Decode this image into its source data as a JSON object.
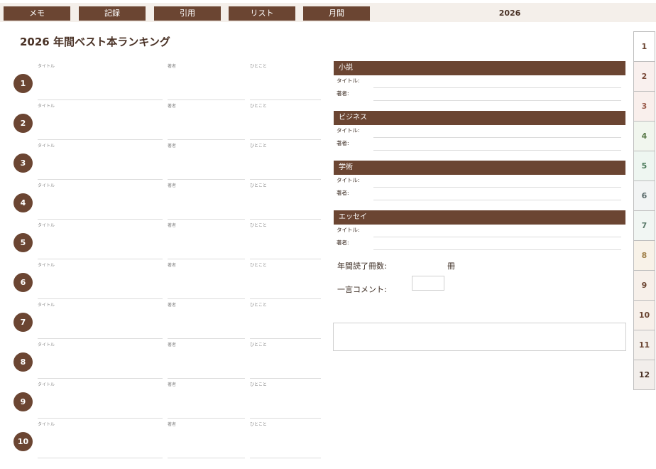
{
  "nav": {
    "tabs": [
      "メモ",
      "記録",
      "引用",
      "リスト",
      "月間"
    ],
    "year": "2026"
  },
  "page_title": "2026 年間ベスト本ランキング",
  "ranking": {
    "col_labels": {
      "title": "タイトル",
      "author": "著者",
      "note": "ひとこと"
    },
    "ranks": [
      "1",
      "2",
      "3",
      "4",
      "5",
      "6",
      "7",
      "8",
      "9",
      "10"
    ]
  },
  "categories": [
    {
      "name": "小説",
      "title_label": "タイトル:",
      "author_label": "著者:"
    },
    {
      "name": "ビジネス",
      "title_label": "タイトル:",
      "author_label": "著者:"
    },
    {
      "name": "学術",
      "title_label": "タイトル:",
      "author_label": "著者:"
    },
    {
      "name": "エッセイ",
      "title_label": "タイトル:",
      "author_label": "著者:"
    }
  ],
  "stats": {
    "annual_count_label": "年間読了冊数:",
    "unit": "冊",
    "comment_label": "一言コメント:"
  },
  "month_tabs": [
    {
      "label": "1",
      "color": "#6b4532",
      "bg": "#ffffff"
    },
    {
      "label": "2",
      "color": "#7a4a3a",
      "bg": "#f9f0ee"
    },
    {
      "label": "3",
      "color": "#9a5a4a",
      "bg": "#f9efec"
    },
    {
      "label": "4",
      "color": "#5a7a4a",
      "bg": "#f1f6ee"
    },
    {
      "label": "5",
      "color": "#4a7a5a",
      "bg": "#eef6f1"
    },
    {
      "label": "6",
      "color": "#5a6a6a",
      "bg": "#f2f4f4"
    },
    {
      "label": "7",
      "color": "#5a7a6a",
      "bg": "#f1f6f3"
    },
    {
      "label": "8",
      "color": "#a0804a",
      "bg": "#f8f2e8"
    },
    {
      "label": "9",
      "color": "#6b4532",
      "bg": "#f7f0ea"
    },
    {
      "label": "10",
      "color": "#6b4532",
      "bg": "#f7f0ea"
    },
    {
      "label": "11",
      "color": "#6b4532",
      "bg": "#f4f0ec"
    },
    {
      "label": "12",
      "color": "#4a3226",
      "bg": "#f2eeeb"
    }
  ],
  "colors": {
    "accent": "#6b4532",
    "topbar_bg": "#f4efea"
  }
}
